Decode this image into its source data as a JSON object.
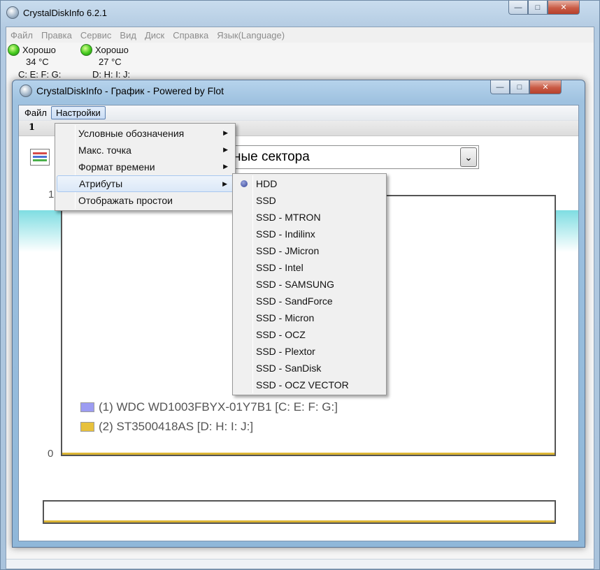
{
  "main_window": {
    "title": "CrystalDiskInfo 6.2.1",
    "caption": {
      "minimize": "—",
      "maximize": "□",
      "close": "✕"
    },
    "menu": [
      "Файл",
      "Правка",
      "Сервис",
      "Вид",
      "Диск",
      "Справка",
      "Язык(Language)"
    ],
    "disks": [
      {
        "status": "Хорошо",
        "temp": "34 °C",
        "letters": "C: E: F: G:"
      },
      {
        "status": "Хорошо",
        "temp": "27 °C",
        "letters": "D: H: I: J:"
      }
    ]
  },
  "graph_window": {
    "title": "CrystalDiskInfo - График - Powered by Flot",
    "caption": {
      "minimize": "—",
      "maximize": "□",
      "close": "✕"
    },
    "menu": [
      "Файл",
      "Настройки"
    ],
    "active_menu": "Настройки",
    "toolbar_number": "1",
    "attribute_select": {
      "value": "ные сектора",
      "arrow": "⌄"
    },
    "y_max": "1",
    "y_min": "0",
    "legend": [
      {
        "label": "(1) WDC WD1003FBYX-01Y7B1 [C: E: F: G:]",
        "color": "#9c9cf2"
      },
      {
        "label": "(2) ST3500418AS [D: H: I: J:]",
        "color": "#e7c13c"
      }
    ]
  },
  "settings_menu": {
    "items": [
      {
        "label": "Условные обозначения",
        "submenu": true
      },
      {
        "label": "Макс. точка",
        "submenu": true
      },
      {
        "label": "Формат времени",
        "submenu": true
      },
      {
        "label": "Атрибуты",
        "submenu": true,
        "highlighted": true
      },
      {
        "label": "Отображать простои",
        "submenu": false
      }
    ],
    "arrow": "▶"
  },
  "attributes_submenu": {
    "selected": "HDD",
    "items": [
      "HDD",
      "SSD",
      "SSD - MTRON",
      "SSD - Indilinx",
      "SSD - JMicron",
      "SSD - Intel",
      "SSD - SAMSUNG",
      "SSD - SandForce",
      "SSD - Micron",
      "SSD - OCZ",
      "SSD - Plextor",
      "SSD - SanDisk",
      "SSD - OCZ VECTOR"
    ]
  }
}
